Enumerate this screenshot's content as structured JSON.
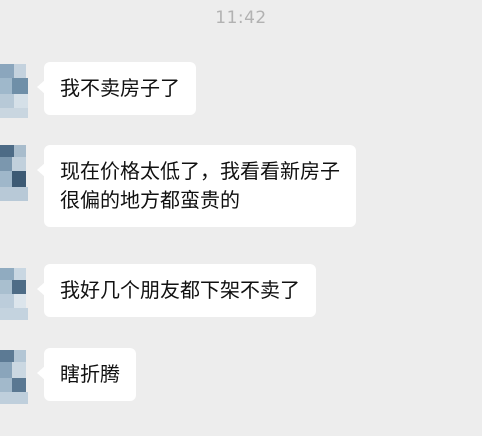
{
  "time": "11:42",
  "messages": [
    {
      "lines": [
        "我不卖房子了"
      ]
    },
    {
      "lines": [
        "现在价格太低了，我看看新房子",
        "很偏的地方都蛮贵的"
      ]
    },
    {
      "lines": [
        "我好几个朋友都下架不卖了"
      ]
    },
    {
      "lines": [
        "瞎折腾"
      ]
    }
  ],
  "colors": {
    "background": "#ededed",
    "bubble": "#ffffff",
    "timestamp": "#b2b2b2"
  },
  "icons": [
    "avatar-mosaic"
  ]
}
